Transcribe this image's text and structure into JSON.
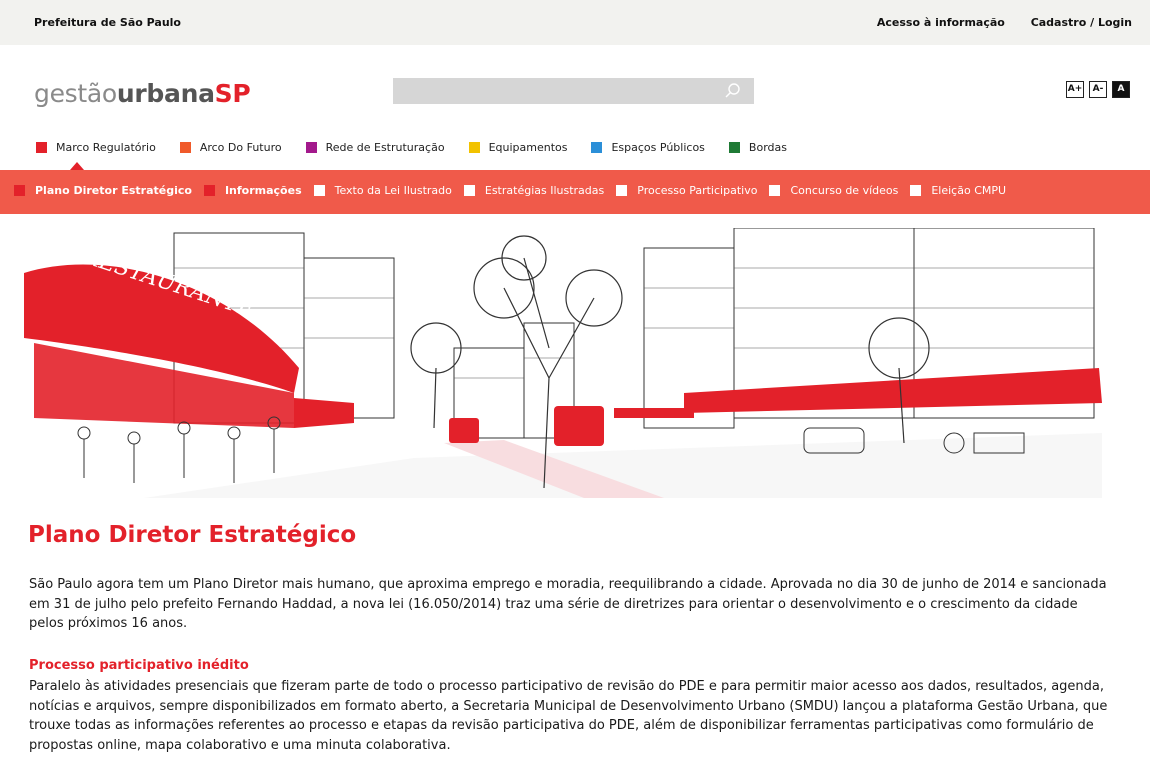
{
  "topbar": {
    "org": "Prefeitura de São Paulo",
    "access": "Acesso à informação",
    "login": "Cadastro / Login"
  },
  "logo": {
    "part1": "gestão",
    "part2": "urbana",
    "part3": "SP"
  },
  "search": {
    "placeholder": "",
    "icon": "search-icon"
  },
  "font_controls": {
    "increase": "A+",
    "decrease": "A-",
    "contrast": "A"
  },
  "categories": [
    {
      "label": "Marco Regulatório",
      "color": "#e3212a"
    },
    {
      "label": "Arco Do Futuro",
      "color": "#f05a2a"
    },
    {
      "label": "Rede de Estruturação",
      "color": "#a3198c"
    },
    {
      "label": "Equipamentos",
      "color": "#f2c200"
    },
    {
      "label": "Espaços Públicos",
      "color": "#2b8fd8"
    },
    {
      "label": "Bordas",
      "color": "#1f7a35"
    }
  ],
  "subnav": [
    {
      "label": "Plano Diretor Estratégico",
      "active": true
    },
    {
      "label": "Informações",
      "active": true
    },
    {
      "label": "Texto da Lei Ilustrado",
      "active": false
    },
    {
      "label": "Estratégias Ilustradas",
      "active": false
    },
    {
      "label": "Processo Participativo",
      "active": false
    },
    {
      "label": "Concurso de vídeos",
      "active": false
    },
    {
      "label": "Eleição CMPU",
      "active": false
    }
  ],
  "hero": {
    "sign_text": "RESTAURANTE"
  },
  "article": {
    "title": "Plano Diretor Estratégico",
    "intro": "São Paulo agora tem um Plano Diretor mais humano, que aproxima emprego e moradia, reequilibrando a cidade. Aprovada no dia 30 de junho de 2014 e sancionada em 31 de julho pelo prefeito Fernando Haddad, a nova lei (16.050/2014) traz uma série de diretrizes para orientar o desenvolvimento e o crescimento da cidade pelos próximos 16 anos.",
    "subheading": "Processo participativo inédito",
    "body": "Paralelo às atividades presenciais que fizeram parte de todo o processo participativo de revisão do PDE e para permitir maior acesso aos dados, resultados, agenda, notícias e arquivos, sempre disponibilizados em formato aberto, a Secretaria Municipal de Desenvolvimento Urbano (SMDU) lançou a plataforma Gestão Urbana, que trouxe todas as informações referentes ao processo e etapas da revisão participativa do PDE, além de disponibilizar ferramentas participativas como formulário de propostas online, mapa colaborativo e uma minuta colaborativa."
  }
}
